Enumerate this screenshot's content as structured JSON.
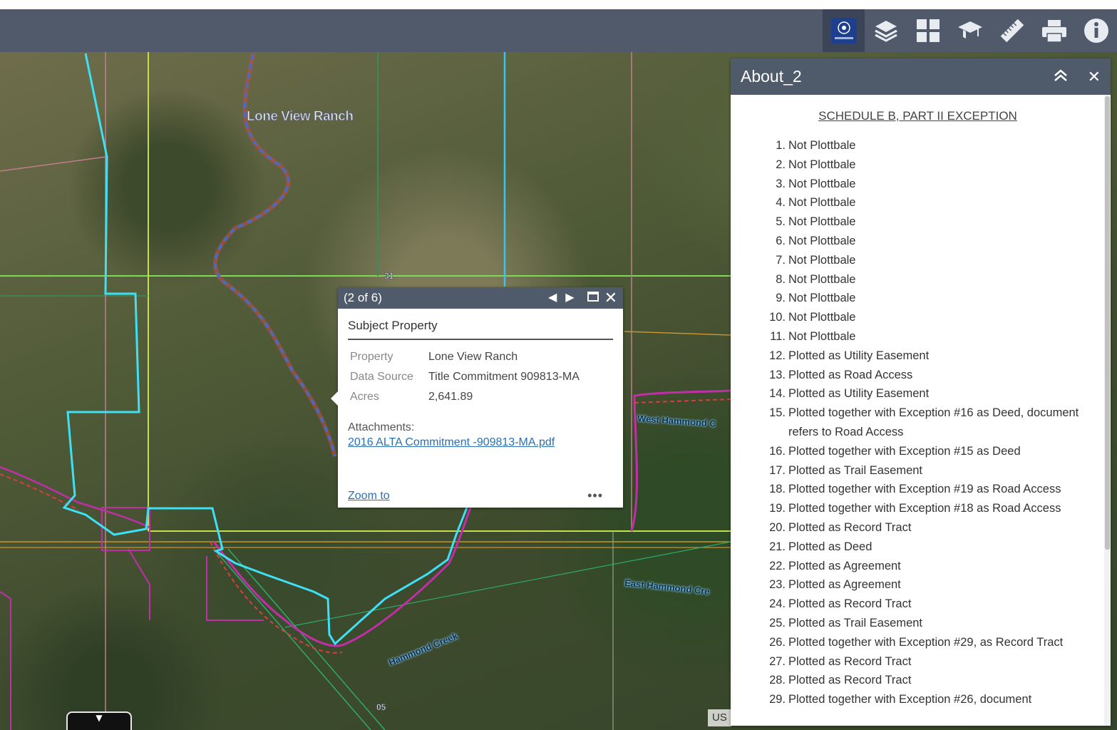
{
  "toolbar": {
    "tools": [
      {
        "icon": "logo-icon",
        "label": "Logo"
      },
      {
        "icon": "layers-icon",
        "label": "Layer List"
      },
      {
        "icon": "basemap-gallery-icon",
        "label": "Basemap Gallery"
      },
      {
        "icon": "about-hat-icon",
        "label": "About"
      },
      {
        "icon": "measure-ruler-icon",
        "label": "Measurement"
      },
      {
        "icon": "print-icon",
        "label": "Print"
      },
      {
        "icon": "info-icon",
        "label": "Info"
      }
    ]
  },
  "map": {
    "labels": {
      "ranch": "Lone View Ranch",
      "west_creek": "West Hammond C",
      "east_creek": "East Hammond Cre",
      "creek": "Hammond Creek",
      "section_top": "31",
      "section_bottom": "05"
    },
    "attribution": "US"
  },
  "popup": {
    "counter": "(2 of 6)",
    "title": "Subject Property",
    "fields": [
      {
        "key": "Property",
        "value": "Lone View Ranch"
      },
      {
        "key": "Data Source",
        "value": "Title Commitment 909813-MA"
      },
      {
        "key": "Acres",
        "value": "2,641.89"
      }
    ],
    "attachments_label": "Attachments:",
    "attachment_link": "2016 ALTA Commitment -909813-MA.pdf",
    "zoom_label": "Zoom to",
    "more_label": "•••"
  },
  "panel": {
    "title": "About_2",
    "heading": "SCHEDULE B, PART II EXCEPTION",
    "items": [
      {
        "n": "1.",
        "t": "Not Plottbale"
      },
      {
        "n": "2.",
        "t": "Not Plottbale"
      },
      {
        "n": "3.",
        "t": "Not Plottbale"
      },
      {
        "n": "4.",
        "t": "Not Plottbale"
      },
      {
        "n": "5.",
        "t": "Not Plottbale"
      },
      {
        "n": "6.",
        "t": "Not Plottbale"
      },
      {
        "n": "7.",
        "t": "Not Plottbale"
      },
      {
        "n": "8.",
        "t": "Not Plottbale"
      },
      {
        "n": "9.",
        "t": "Not Plottbale"
      },
      {
        "n": "10.",
        "t": "Not Plottbale"
      },
      {
        "n": "11.",
        "t": "Not Plottbale"
      },
      {
        "n": "12.",
        "t": "Plotted as Utility Easement"
      },
      {
        "n": "13.",
        "t": "Plotted as Road Access"
      },
      {
        "n": "14.",
        "t": "Plotted as Utility Easement"
      },
      {
        "n": "15.",
        "t": "Plotted together with Exception #16 as Deed, document refers to Road Access"
      },
      {
        "n": "16.",
        "t": "Plotted together with Exception #15 as Deed"
      },
      {
        "n": "17.",
        "t": "Plotted as Trail Easement"
      },
      {
        "n": "18.",
        "t": "Plotted together with Exception #19 as Road Access"
      },
      {
        "n": "19.",
        "t": "Plotted together with Exception #18 as Road Access"
      },
      {
        "n": "20.",
        "t": "Plotted as Record Tract"
      },
      {
        "n": "21.",
        "t": "Plotted as Deed"
      },
      {
        "n": "22.",
        "t": "Plotted as Agreement"
      },
      {
        "n": "23.",
        "t": "Plotted as Agreement"
      },
      {
        "n": "24.",
        "t": "Plotted as Record Tract"
      },
      {
        "n": "25.",
        "t": "Plotted as Trail Easement"
      },
      {
        "n": "26.",
        "t": "Plotted together with Exception #29, as Record Tract"
      },
      {
        "n": "27.",
        "t": "Plotted as Record Tract"
      },
      {
        "n": "28.",
        "t": "Plotted as Record Tract"
      },
      {
        "n": "29.",
        "t": "Plotted together with Exception #26, document"
      }
    ]
  },
  "colors": {
    "header": "#505a6b",
    "subject_boundary": "#3fe0f5",
    "parcel_lines": "#c12fa8",
    "section_lines": "#7ed957",
    "creek_dashed": "#3b6fd6"
  }
}
